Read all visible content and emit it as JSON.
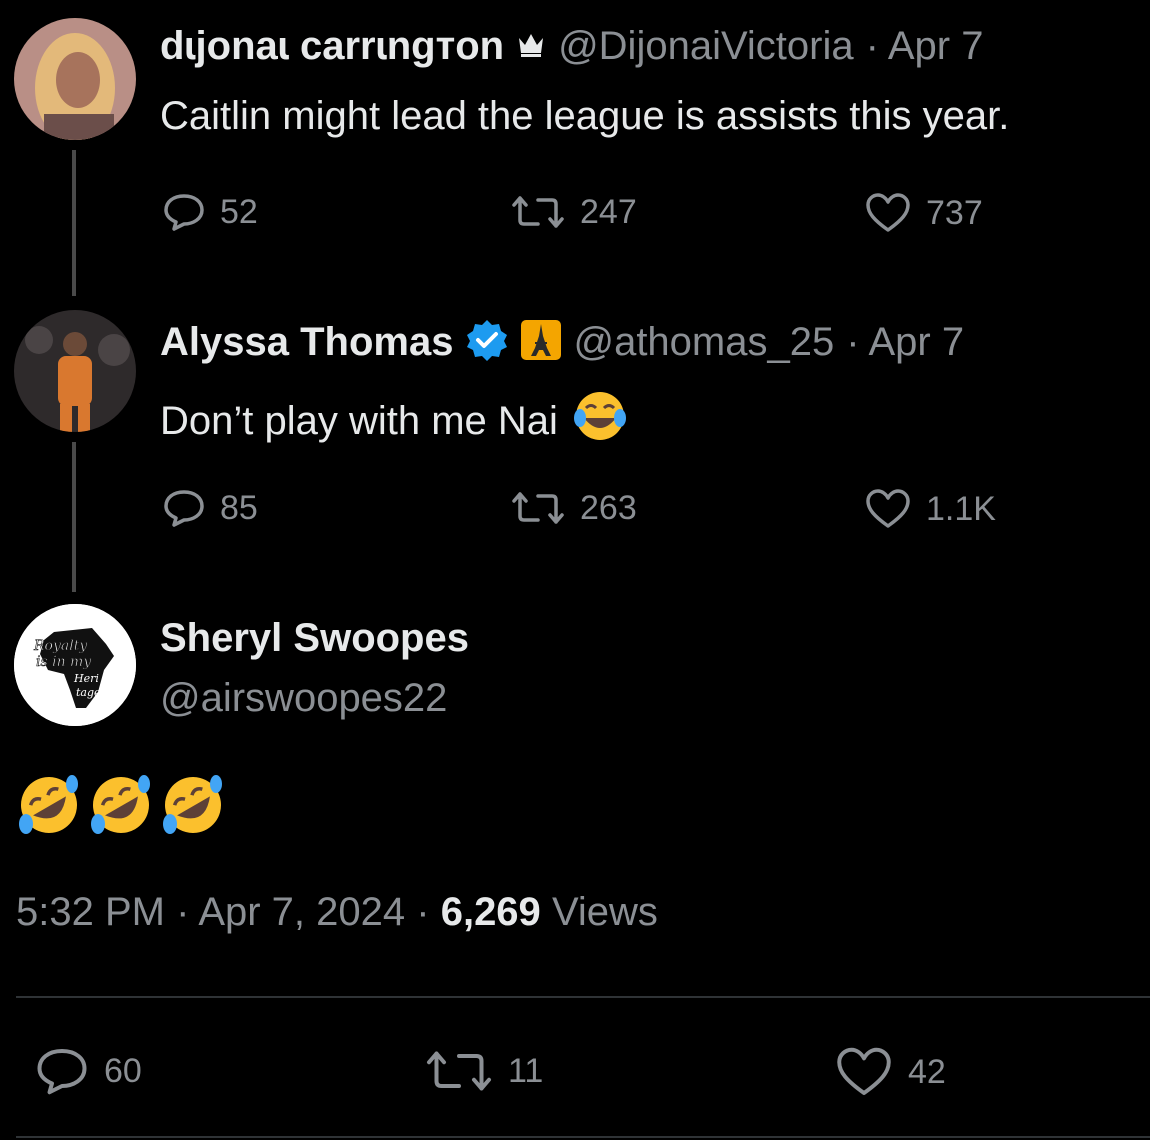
{
  "tweets": [
    {
      "display_name": "dɩjonaɩ carrɩngтon",
      "name_icon": "crown-icon",
      "handle": "@DijonaiVictoria",
      "date": "· Apr 7",
      "text": "Caitlin might lead the league is assists this year.",
      "replies": "52",
      "retweets": "247",
      "likes": "737"
    },
    {
      "display_name": "Alyssa Thomas",
      "name_icons": [
        "verified-badge-icon",
        "eiffel-tower-icon"
      ],
      "handle": "@athomas_25",
      "date": "· Apr 7",
      "text": "Don’t play with me Nai",
      "text_emoji": "face-with-tears-of-joy",
      "replies": "85",
      "retweets": "263",
      "likes": "1.1K"
    }
  ],
  "main_tweet": {
    "display_name": "Sheryl Swoopes",
    "handle": "@airswoopes22",
    "avatar_text": [
      "Royalty",
      "is in my",
      "Heri",
      "tage"
    ],
    "text_emoji": [
      "rolling-on-floor-laughing",
      "rolling-on-floor-laughing",
      "rolling-on-floor-laughing"
    ],
    "time": "5:32 PM",
    "date": "· Apr 7, 2024 ·",
    "views_count": "6,269",
    "views_label": "Views",
    "replies": "60",
    "retweets": "11",
    "likes": "42"
  },
  "colors": {
    "background": "#000000",
    "text": "#e7e9ea",
    "muted": "#8b8f94",
    "verified": "#1d9bf0",
    "divider": "#2f3336"
  }
}
